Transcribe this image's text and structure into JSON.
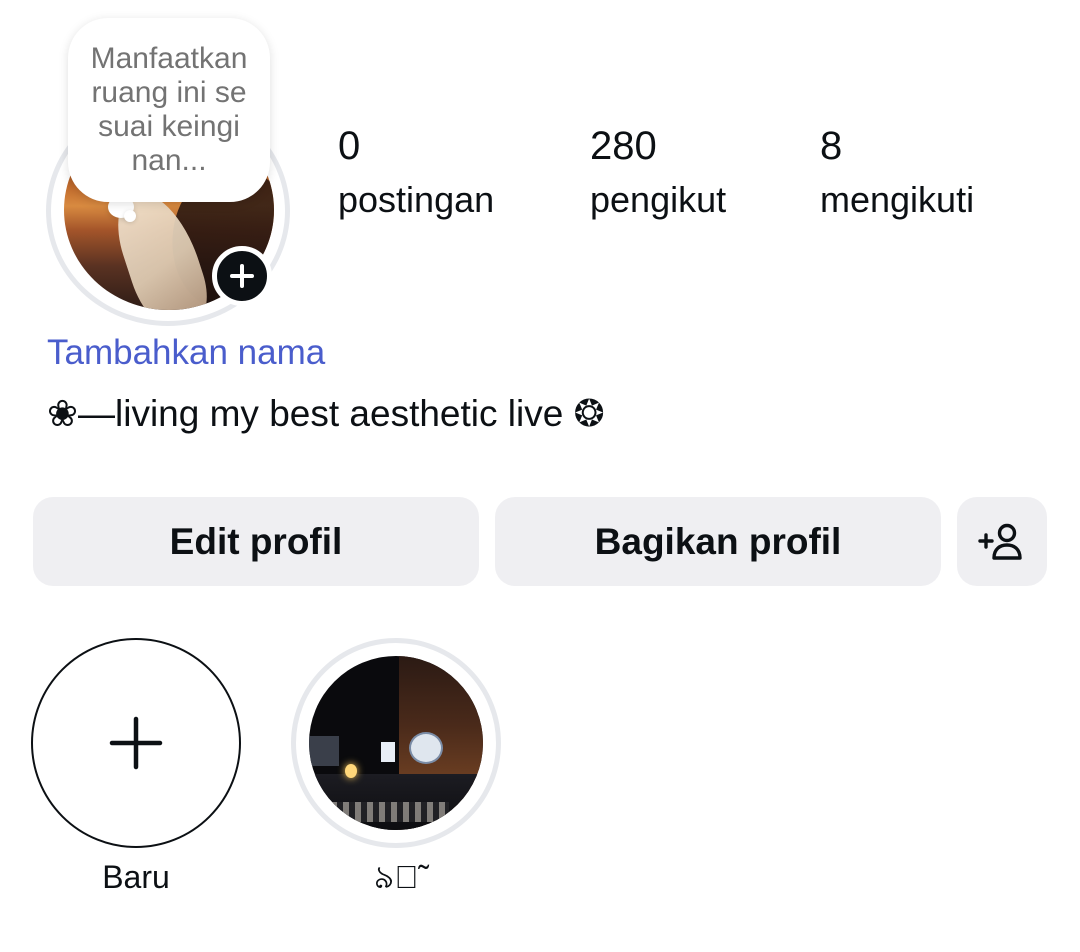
{
  "profile": {
    "note_text": "Manfaatkan ruang ini sesuai keinginan...",
    "add_name_label": "Tambahkan nama",
    "bio": "❀―living my best aesthetic live ❂"
  },
  "stats": [
    {
      "count": "0",
      "label": "postingan"
    },
    {
      "count": "280",
      "label": "pengikut"
    },
    {
      "count": "8",
      "label": "mengikuti"
    }
  ],
  "actions": {
    "edit_label": "Edit profil",
    "share_label": "Bagikan profil",
    "discover_icon": "add-person-icon"
  },
  "highlights": {
    "new_label": "Baru",
    "items": [
      {
        "label": "৯৩̃"
      }
    ]
  },
  "colors": {
    "link": "#4a5dcc",
    "button_bg": "#efeff2",
    "text": "#0c1014",
    "muted": "#737373",
    "ring": "#e6e8ec"
  }
}
